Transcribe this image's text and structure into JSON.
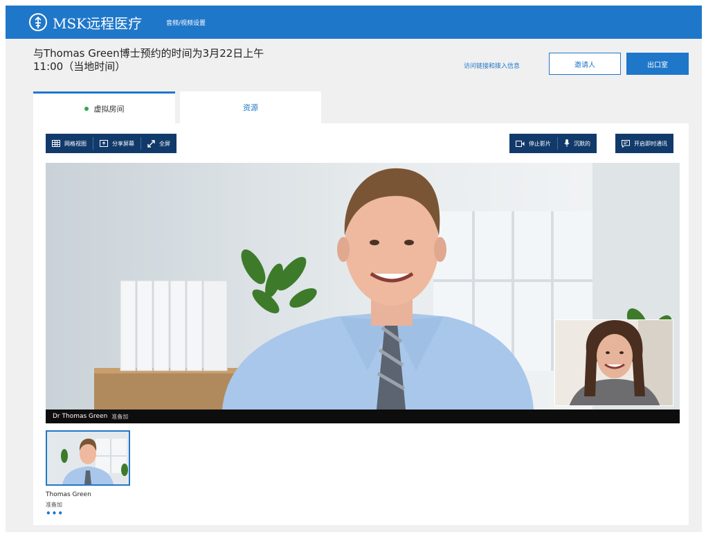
{
  "header": {
    "brand": "MSK远程医疗",
    "av_settings_link": "音频/视频设置"
  },
  "appointment": {
    "text": "与Thomas Green博士预约的时间为3月22日上午11:00（当地时间）"
  },
  "actions": {
    "info_link": "访问链接和拨入信息",
    "invite_label": "邀请人",
    "exit_label": "出口室"
  },
  "tabs": [
    {
      "label": "虚拟房间",
      "active": true
    },
    {
      "label": "资源",
      "active": false
    }
  ],
  "toolbar": {
    "grid_label": "网格视图",
    "share_label": "分享屏幕",
    "fullscreen_label": "全屏",
    "video_label": "停止影片",
    "mute_label": "沉默的",
    "chat_label": "开启即时通讯"
  },
  "video": {
    "speaker_name": "Dr Thomas Green",
    "speaker_status": "准备加"
  },
  "participants": [
    {
      "name": "Thomas Green",
      "status": "准备加",
      "more": "•••"
    }
  ],
  "colors": {
    "primary": "#1f77c9",
    "toolbar": "#113a6b",
    "status_green": "#2ea84f"
  }
}
